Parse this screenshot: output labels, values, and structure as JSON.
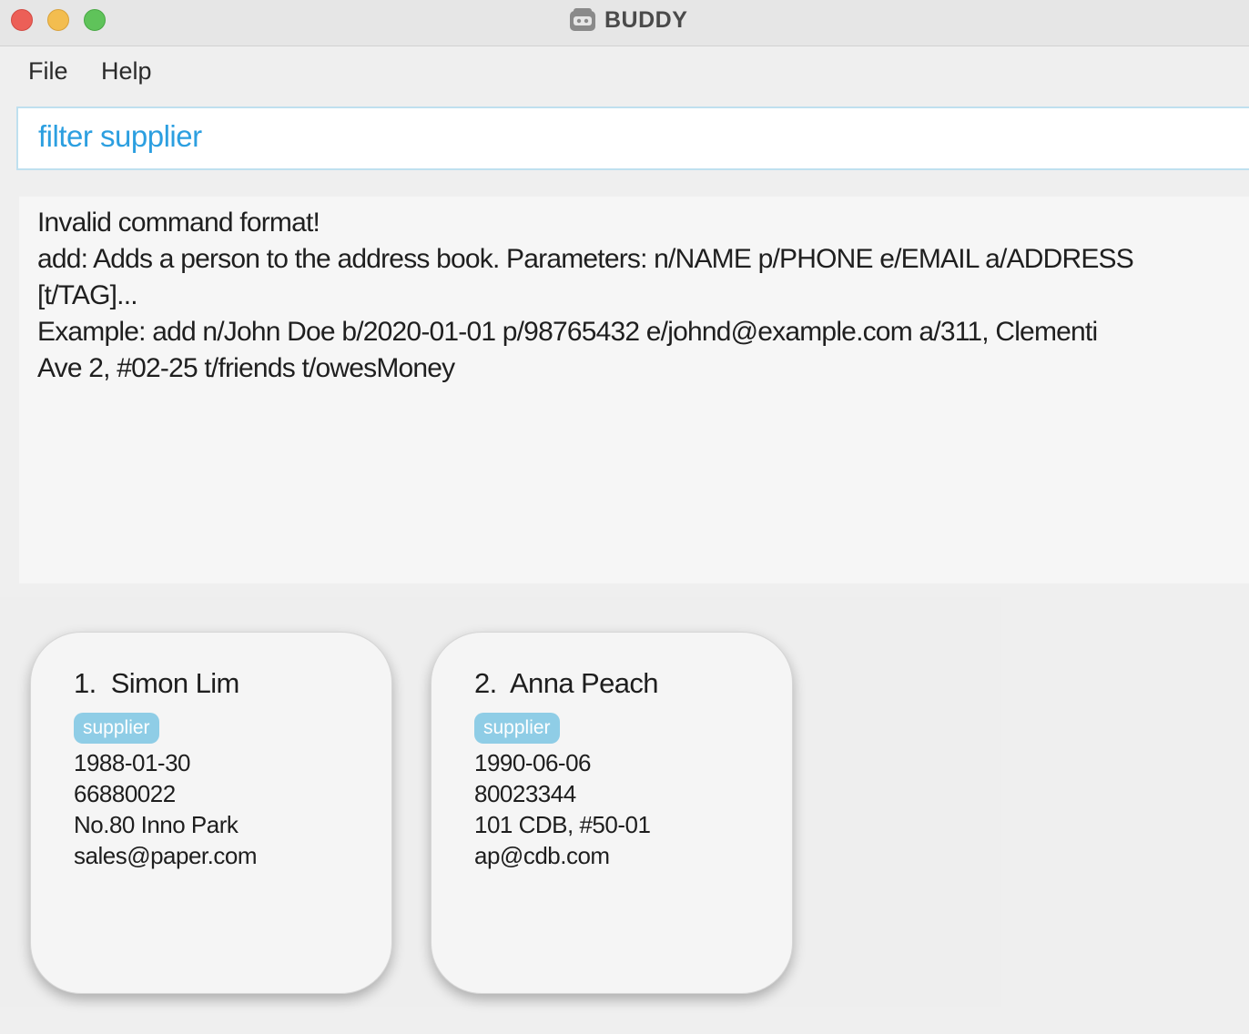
{
  "window": {
    "title": "BUDDY"
  },
  "menu": {
    "items": [
      {
        "label": "File"
      },
      {
        "label": "Help"
      }
    ]
  },
  "command": {
    "value": "filter supplier"
  },
  "result": {
    "lines": [
      "Invalid command format!",
      "add: Adds a person to the address book. Parameters: n/NAME p/PHONE e/EMAIL a/ADDRESS",
      "[t/TAG]...",
      "Example: add n/John Doe b/2020-01-01 p/98765432 e/johnd@example.com a/311, Clementi",
      "Ave 2, #02-25 t/friends t/owesMoney"
    ]
  },
  "persons": [
    {
      "index": "1.",
      "name": "Simon Lim",
      "tag": "supplier",
      "birthday": "1988-01-30",
      "phone": "66880022",
      "address": "No.80 Inno Park",
      "email": "sales@paper.com"
    },
    {
      "index": "2.",
      "name": "Anna Peach",
      "tag": "supplier",
      "birthday": "1990-06-06",
      "phone": "80023344",
      "address": "101 CDB, #50-01",
      "email": "ap@cdb.com"
    }
  ],
  "colors": {
    "accent": "#2c9fe0",
    "tag_background": "#8fcde6",
    "close": "#ec5f57",
    "minimize": "#f3bd4f",
    "maximize": "#5fc35a"
  }
}
